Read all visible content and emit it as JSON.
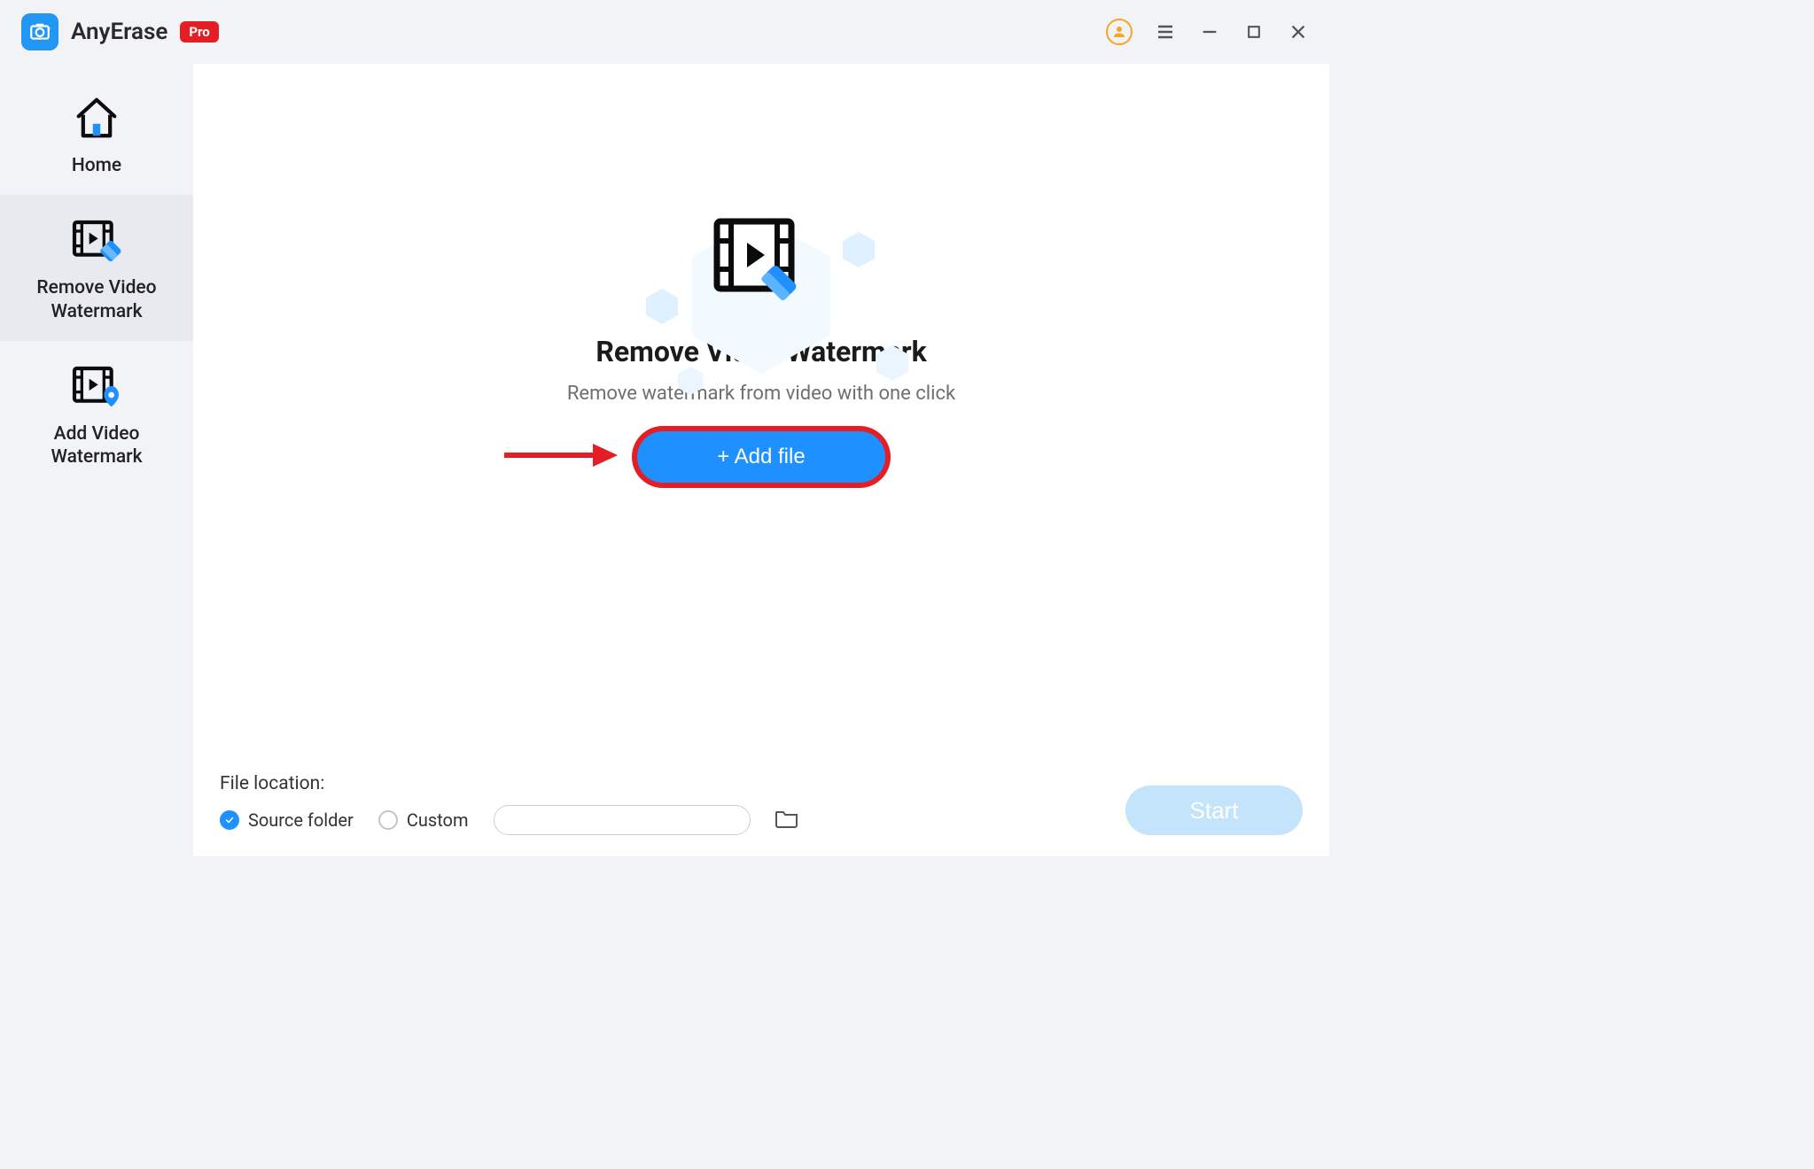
{
  "app": {
    "name": "AnyErase",
    "badge": "Pro"
  },
  "sidebar": {
    "home": "Home",
    "remove": "Remove Video Watermark",
    "add": "Add Video Watermark"
  },
  "hero": {
    "title": "Remove Video Watermark",
    "subtitle": "Remove watermark from video with one click",
    "add_button": "+ Add file"
  },
  "footer": {
    "file_location_label": "File location:",
    "option_source": "Source folder",
    "option_custom": "Custom",
    "custom_path": "",
    "start_button": "Start"
  }
}
